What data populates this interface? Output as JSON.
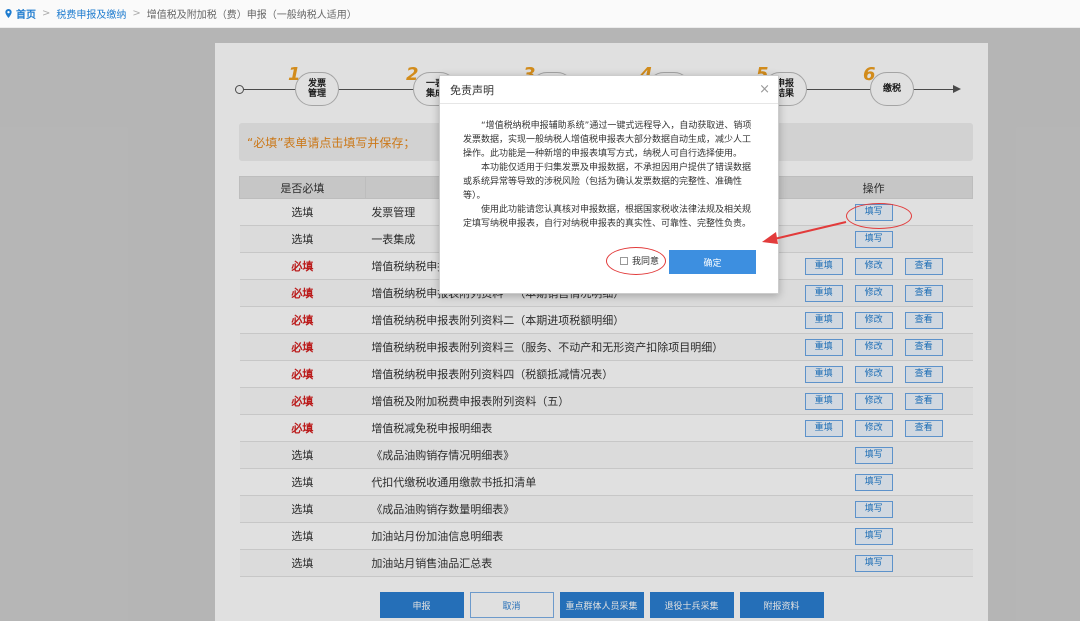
{
  "breadcrumb": {
    "home": "首页",
    "level1": "税费申报及缴纳",
    "level2": "增值税及附加税（费）申报（一般纳税人适用）"
  },
  "steps": [
    {
      "num": "1",
      "label": "发票管理"
    },
    {
      "num": "2",
      "label": "一表集成"
    },
    {
      "num": "3",
      "label": ""
    },
    {
      "num": "4",
      "label": ""
    },
    {
      "num": "5",
      "label": "申报结果"
    },
    {
      "num": "6",
      "label": "缴税"
    }
  ],
  "notice": "“必填”表单请点击填写并保存；",
  "table": {
    "headers": [
      "是否必填",
      "",
      "操作"
    ],
    "rows": [
      {
        "req": "选填",
        "must": false,
        "name": "发票管理",
        "ops": [
          "填写"
        ]
      },
      {
        "req": "选填",
        "must": false,
        "name": "一表集成",
        "ops": [
          "填写"
        ]
      },
      {
        "req": "必填",
        "must": true,
        "name": "增值税纳税申报表",
        "ops": [
          "重填",
          "修改",
          "查看"
        ]
      },
      {
        "req": "必填",
        "must": true,
        "name": "增值税纳税申报表附列资料一（本期销售情况明细）",
        "ops": [
          "重填",
          "修改",
          "查看"
        ]
      },
      {
        "req": "必填",
        "must": true,
        "name": "增值税纳税申报表附列资料二（本期进项税额明细）",
        "ops": [
          "重填",
          "修改",
          "查看"
        ]
      },
      {
        "req": "必填",
        "must": true,
        "name": "增值税纳税申报表附列资料三（服务、不动产和无形资产扣除项目明细）",
        "ops": [
          "重填",
          "修改",
          "查看"
        ]
      },
      {
        "req": "必填",
        "must": true,
        "name": "增值税纳税申报表附列资料四（税额抵减情况表）",
        "ops": [
          "重填",
          "修改",
          "查看"
        ]
      },
      {
        "req": "必填",
        "must": true,
        "name": "增值税及附加税费申报表附列资料（五）",
        "ops": [
          "重填",
          "修改",
          "查看"
        ]
      },
      {
        "req": "必填",
        "must": true,
        "name": "增值税减免税申报明细表",
        "ops": [
          "重填",
          "修改",
          "查看"
        ]
      },
      {
        "req": "选填",
        "must": false,
        "name": "《成品油购销存情况明细表》",
        "ops": [
          "填写"
        ]
      },
      {
        "req": "选填",
        "must": false,
        "name": "代扣代缴税收通用缴款书抵扣清单",
        "ops": [
          "填写"
        ]
      },
      {
        "req": "选填",
        "must": false,
        "name": "《成品油购销存数量明细表》",
        "ops": [
          "填写"
        ]
      },
      {
        "req": "选填",
        "must": false,
        "name": "加油站月份加油信息明细表",
        "ops": [
          "填写"
        ]
      },
      {
        "req": "选填",
        "must": false,
        "name": "加油站月销售油品汇总表",
        "ops": [
          "填写"
        ]
      }
    ]
  },
  "bottom_buttons": [
    {
      "label": "申报",
      "style": "primary"
    },
    {
      "label": "取消",
      "style": "ghost"
    },
    {
      "label": "重点群体人员采集",
      "style": "primary"
    },
    {
      "label": "退役士兵采集",
      "style": "primary"
    },
    {
      "label": "附报资料",
      "style": "primary"
    }
  ],
  "dialog": {
    "title": "免责声明",
    "close": "×",
    "paragraphs": [
      "“增值税纳税申报辅助系统”通过一键式远程导入，自动获取进、销项发票数据，实现一般纳税人增值税申报表大部分数据自动生成，减少人工操作。此功能是一种新增的申报表填写方式，纳税人可自行选择使用。",
      "本功能仅适用于归集发票及申报数据，不承担因用户提供了错误数据或系统异常等导致的涉税风险（包括为确认发票数据的完整性、准确性等）。",
      "使用此功能请您认真核对申报数据，根据国家税收法律法规及相关规定填写纳税申报表，自行对纳税申报表的真实性、可靠性、完整性负责。"
    ],
    "agree_label": "我同意",
    "confirm_label": "确定"
  },
  "colors": {
    "primary": "#2b7fd2",
    "required_red": "#d52020",
    "step_number": "#f0a020",
    "annotation_red": "#e23b3b"
  }
}
